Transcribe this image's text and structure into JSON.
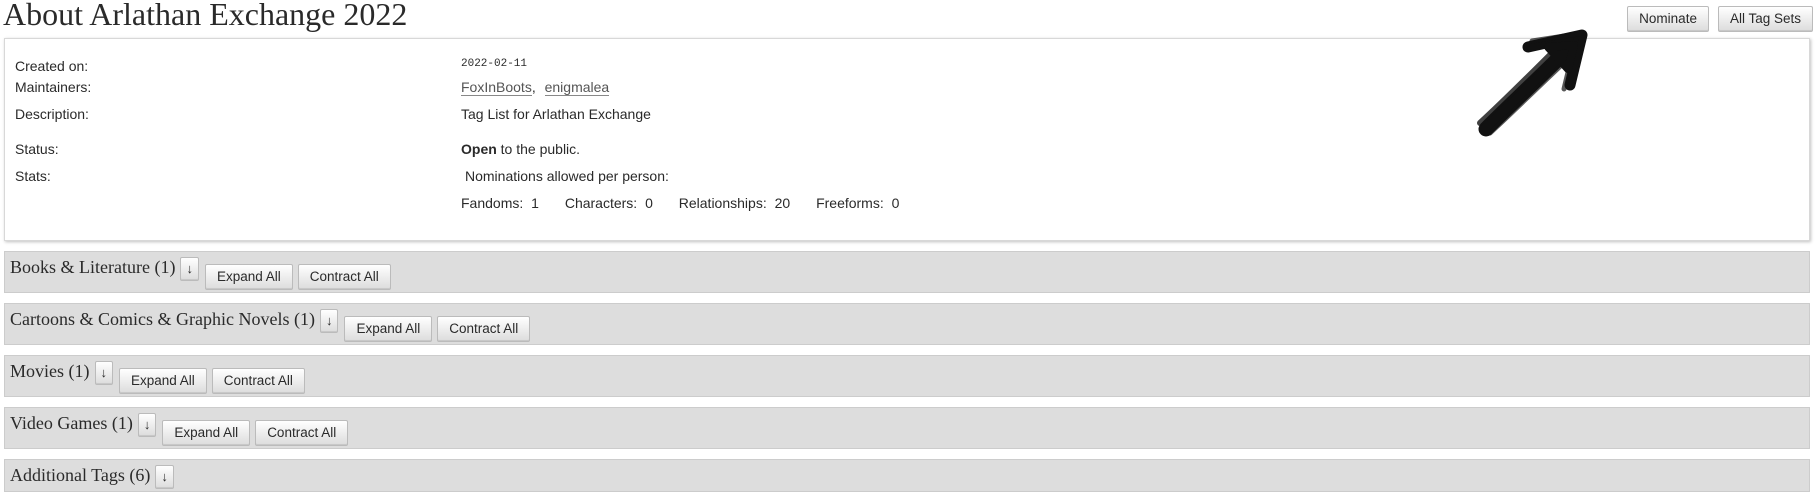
{
  "header": {
    "title": "About Arlathan Exchange 2022",
    "nominate_label": "Nominate",
    "all_tag_sets_label": "All Tag Sets"
  },
  "meta": {
    "created_label": "Created on:",
    "created_value": "2022-02-11",
    "maintainers_label": "Maintainers:",
    "maintainers": [
      "FoxInBoots",
      "enigmalea"
    ],
    "maintainers_sep": ",",
    "description_label": "Description:",
    "description_value": "Tag List for Arlathan Exchange",
    "status_label": "Status:",
    "status_word": "Open",
    "status_rest": "to the public.",
    "stats_label": "Stats:",
    "nominations_text": "Nominations allowed per person:",
    "stats": {
      "fandoms_label": "Fandoms:",
      "fandoms_value": "1",
      "characters_label": "Characters:",
      "characters_value": "0",
      "relationships_label": "Relationships:",
      "relationships_value": "20",
      "freeforms_label": "Freeforms:",
      "freeforms_value": "0"
    }
  },
  "categories": [
    {
      "title": "Books & Literature (1)",
      "toggle": "↓",
      "expand": "Expand All",
      "contract": "Contract All"
    },
    {
      "title": "Cartoons & Comics & Graphic Novels (1)",
      "toggle": "↓",
      "expand": "Expand All",
      "contract": "Contract All"
    },
    {
      "title": "Movies (1)",
      "toggle": "↓",
      "expand": "Expand All",
      "contract": "Contract All"
    },
    {
      "title": "Video Games (1)",
      "toggle": "↓",
      "expand": "Expand All",
      "contract": "Contract All"
    },
    {
      "title": "Additional Tags (6)",
      "toggle": "↓"
    }
  ],
  "colors": {
    "section_bg": "#dddddd",
    "text": "#2a2a2a",
    "link": "#555555",
    "arrow": "#111111"
  },
  "icons": {
    "annotation": "hand-drawn-arrow-icon",
    "toggle": "down-arrow-icon"
  }
}
